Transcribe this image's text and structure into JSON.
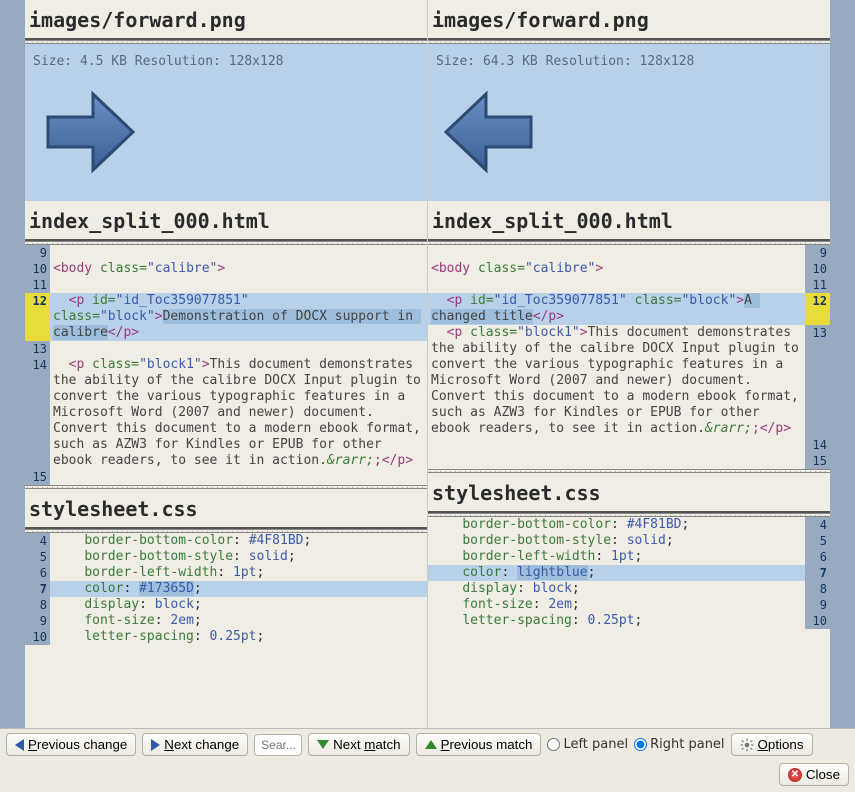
{
  "files": {
    "image": {
      "path": "images/forward.png",
      "left": {
        "size": "4.5 KB",
        "resolution": "128x128"
      },
      "right": {
        "size": "64.3 KB",
        "resolution": "128x128"
      }
    },
    "html": {
      "path": "index_split_000.html",
      "left_lines": {
        "l9": "",
        "l10_tag_open": "<body ",
        "l10_attr": "class=",
        "l10_val": "\"calibre\"",
        "l10_tag_close": ">",
        "l11": "",
        "l12a_open": "<p ",
        "l12a_attr1": "id=",
        "l12a_val1": "\"id_Toc359077851\"",
        "l12b_attr2": "class=",
        "l12b_val2": "\"block\"",
        "l12b_txt": "Demonstration of DOCX support in calibre",
        "l12b_close": "</p>",
        "l13": "",
        "l14_open": "<p ",
        "l14_attr": "class=",
        "l14_val": "\"block1\"",
        "l14_txt": "This document demonstrates the ability of the calibre DOCX Input plugin to convert the various typographic features in a Microsoft Word (2007 and newer) document. Convert this document to a modern ebook format, such as AZW3 for Kindles or EPUB for other ebook readers, to see it in action.",
        "l14_ent": "&rarr;",
        "l14_close": ";</p>",
        "l15": ""
      },
      "right_lines": {
        "l12_txt": "A changed title",
        "l13_open": "<p ",
        "l13_attr": "class=",
        "l13_val": "\"block1\"",
        "l13_txt": "This document demonstrates the ability of the calibre DOCX Input plugin to convert the various typographic features in a Microsoft Word (2007 and newer) document. Convert this document to a modern ebook format, such as AZW3 for Kindles or EPUB for other ebook readers, to see it in action.",
        "l13_ent": "&rarr;",
        "l13_close": ";</p>"
      }
    },
    "css": {
      "path": "stylesheet.css",
      "left": {
        "l4": {
          "prop": "border-bottom-color",
          "val": "#4F81BD"
        },
        "l5": {
          "prop": "border-bottom-style",
          "val": "solid"
        },
        "l6": {
          "prop": "border-left-width",
          "val": "1pt"
        },
        "l7": {
          "prop": "color",
          "val": "#17365D"
        },
        "l8": {
          "prop": "display",
          "val": "block"
        },
        "l9": {
          "prop": "font-size",
          "val": "2em"
        },
        "l10": {
          "prop": "letter-spacing",
          "val": "0.25pt"
        }
      },
      "right": {
        "l4": {
          "prop": "border-bottom-color",
          "val": "#4F81BD"
        },
        "l5": {
          "prop": "border-bottom-style",
          "val": "solid"
        },
        "l6": {
          "prop": "border-left-width",
          "val": "1pt"
        },
        "l7": {
          "prop": "color",
          "val": "lightblue"
        },
        "l8": {
          "prop": "display",
          "val": "block"
        },
        "l9": {
          "prop": "font-size",
          "val": "2em"
        },
        "l10": {
          "prop": "letter-spacing",
          "val": "0.25pt"
        }
      }
    }
  },
  "line_numbers": {
    "html_left": [
      "9",
      "10",
      "11",
      "12",
      "13",
      "14",
      "15"
    ],
    "html_right": [
      "9",
      "10",
      "11",
      "12",
      "13",
      "14",
      "15"
    ],
    "css_left": [
      "4",
      "5",
      "6",
      "7",
      "8",
      "9",
      "10"
    ],
    "css_right": [
      "4",
      "5",
      "6",
      "7",
      "8",
      "9",
      "10"
    ]
  },
  "meta_labels": {
    "size": "Size:",
    "resolution": "Resolution:"
  },
  "toolbar": {
    "prev_change": "Previous change",
    "next_change": "Next change",
    "search_placeholder": "Sear...",
    "next_match": "Next match",
    "prev_match": "Previous match",
    "left_panel": "Left panel",
    "right_panel": "Right panel",
    "options": "Options",
    "close": "Close",
    "selected_panel": "right"
  }
}
